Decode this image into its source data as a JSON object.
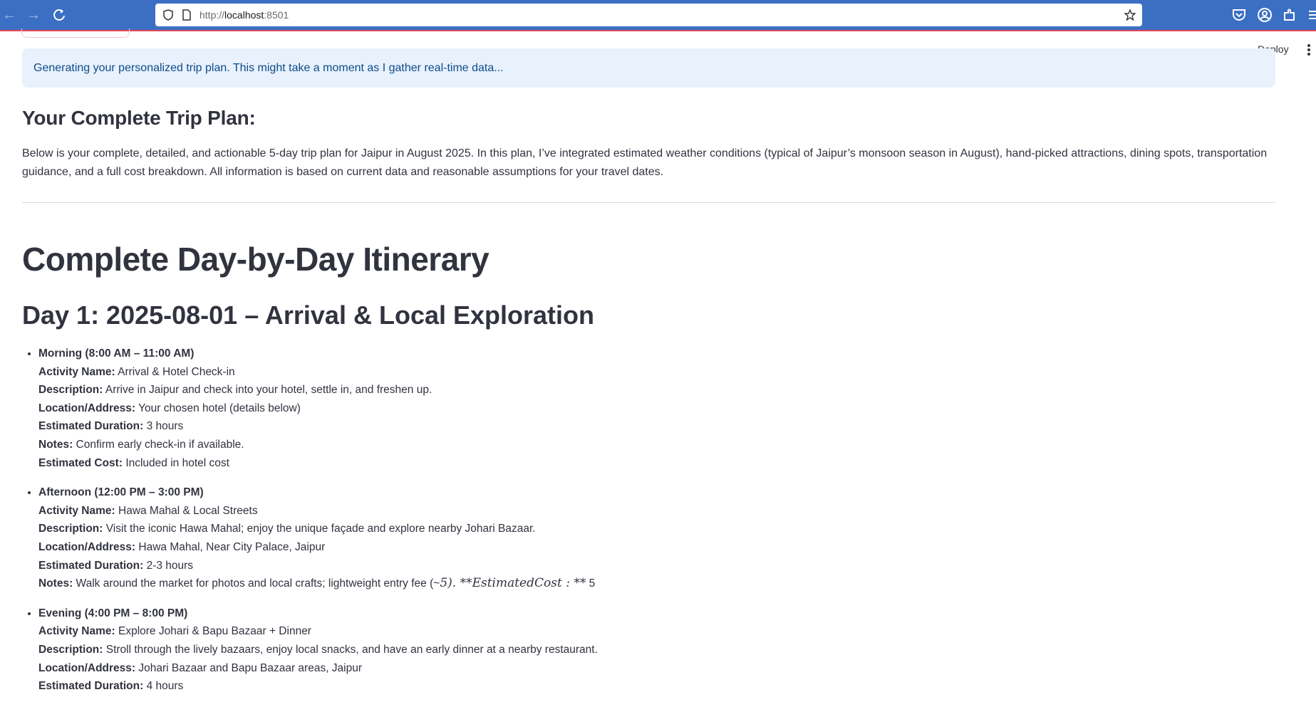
{
  "browser": {
    "url_prefix": "http://",
    "url_host": "localhost",
    "url_port": ":8501"
  },
  "app": {
    "deploy_label": "Deploy",
    "info_message": "Generating your personalized trip plan. This might take a moment as I gather real-time data...",
    "plan_heading": "Your Complete Trip Plan:",
    "intro_text": "Below is your complete, detailed, and actionable 5-day trip plan for Jaipur in August 2025. In this plan, I’ve integrated estimated weather conditions (typical of Jaipur’s monsoon season in August), hand-picked attractions, dining spots, transportation guidance, and a full cost breakdown. All information is based on current data and reasonable assumptions for your travel dates.",
    "itinerary_heading": "Complete Day-by-Day Itinerary",
    "day_heading": "Day 1: 2025-08-01 – Arrival & Local Exploration"
  },
  "labels": {
    "activity": "Activity Name:",
    "description": "Description:",
    "location": "Location/Address:",
    "duration": "Estimated Duration:",
    "notes": "Notes:",
    "cost": "Estimated Cost:"
  },
  "periods": [
    {
      "title": "Morning (8:00 AM – 11:00 AM)",
      "activity": "Arrival & Hotel Check-in",
      "description": "Arrive in Jaipur and check into your hotel, settle in, and freshen up.",
      "location": "Your chosen hotel (details below)",
      "duration": "3 hours",
      "notes": "Confirm early check-in if available.",
      "cost": "Included in hotel cost"
    },
    {
      "title": "Afternoon (12:00 PM – 3:00 PM)",
      "activity": "Hawa Mahal & Local Streets",
      "description": "Visit the iconic Hawa Mahal; enjoy the unique façade and explore nearby Johari Bazaar.",
      "location": "Hawa Mahal, Near City Palace, Jaipur",
      "duration": "2-3 hours",
      "notes_text": "Walk around the market for photos and local crafts; lightweight entry fee (~",
      "notes_math": "5). **EstimatedCost : **",
      "notes_tail": "5"
    },
    {
      "title": "Evening (4:00 PM – 8:00 PM)",
      "activity": "Explore Johari & Bapu Bazaar + Dinner",
      "description": "Stroll through the lively bazaars, enjoy local snacks, and have an early dinner at a nearby restaurant.",
      "location": "Johari Bazaar and Bapu Bazaar areas, Jaipur",
      "duration": "4 hours"
    }
  ]
}
